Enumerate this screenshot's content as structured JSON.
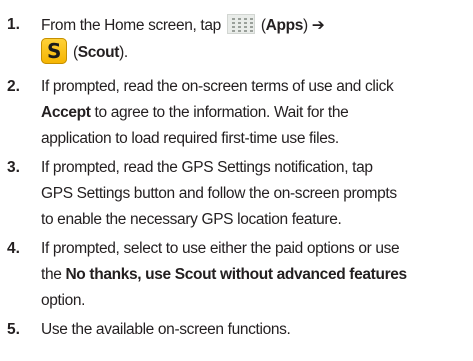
{
  "steps": [
    {
      "number": "1.",
      "lines": [
        [
          "From the Home screen, tap ",
          "",
          " (",
          "Apps",
          ") ",
          "➔"
        ],
        [
          "",
          " (",
          "Scout",
          ")."
        ]
      ]
    },
    {
      "number": "2.",
      "lines": [
        [
          "If prompted, read the on-screen terms of use and click"
        ],
        [
          "Accept",
          " to agree to the information. Wait for the"
        ],
        [
          "application to load required first-time use files."
        ]
      ]
    },
    {
      "number": "3.",
      "lines": [
        [
          "If prompted, read the GPS Settings notification, tap"
        ],
        [
          "GPS Settings button and follow the on-screen prompts"
        ],
        [
          "to enable the necessary GPS location feature."
        ]
      ]
    },
    {
      "number": "4.",
      "lines": [
        [
          "If prompted, select to use either the paid options or use"
        ],
        [
          "the ",
          "No thanks, use Scout without advanced features"
        ],
        [
          "option."
        ]
      ]
    },
    {
      "number": "5.",
      "lines": [
        [
          "Use the available on-screen functions."
        ]
      ]
    }
  ],
  "icons": {
    "apps": "apps-grid-icon",
    "scout": "scout-app-icon",
    "scout_letter": "S"
  }
}
